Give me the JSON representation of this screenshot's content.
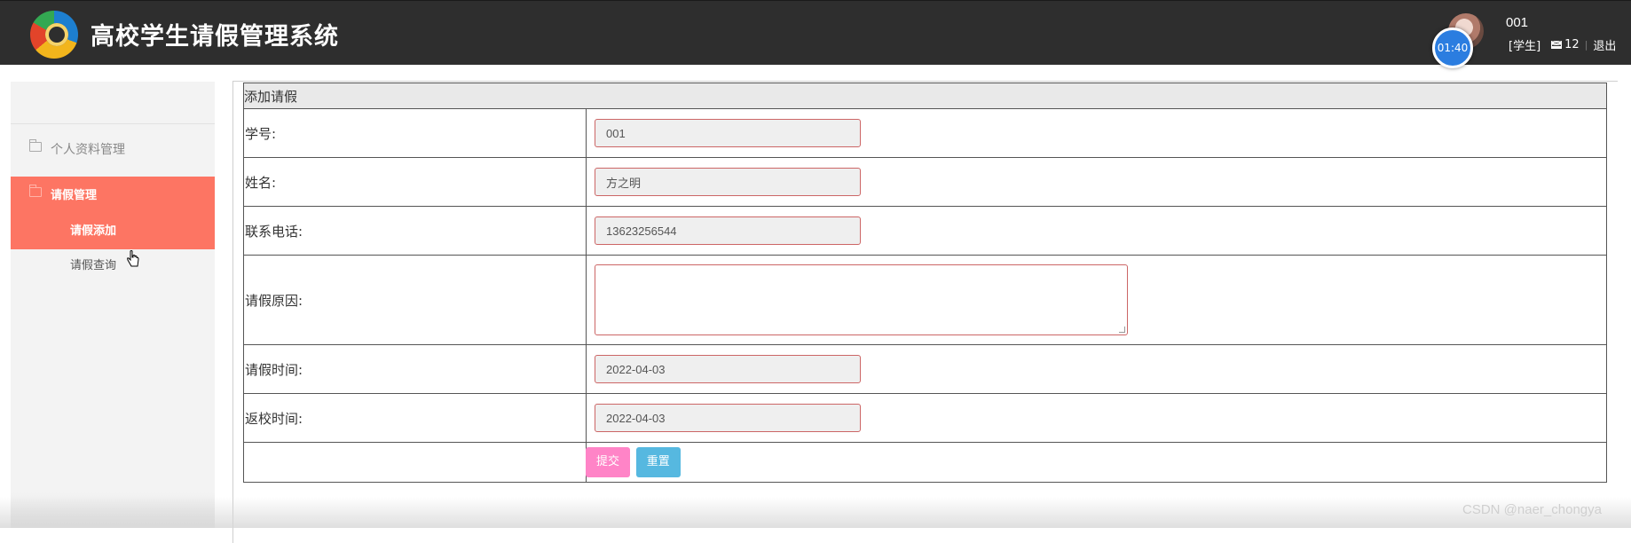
{
  "header": {
    "app_title": "高校学生请假管理系统",
    "timer": "01:40",
    "username": "001",
    "role": "[学生]",
    "mail_count": "12",
    "logout": "退出"
  },
  "sidebar": {
    "items": [
      {
        "label": "个人资料管理"
      },
      {
        "label": "请假管理",
        "children": [
          {
            "label": "请假添加"
          },
          {
            "label": "请假查询"
          }
        ]
      }
    ]
  },
  "form": {
    "caption": "添加请假",
    "fields": [
      {
        "label": "学号:",
        "value": "001"
      },
      {
        "label": "姓名:",
        "value": "方之明"
      },
      {
        "label": "联系电话:",
        "value": "13623256544"
      },
      {
        "label": "请假原因:",
        "value": ""
      },
      {
        "label": "请假时间:",
        "value": "2022-04-03"
      },
      {
        "label": "返校时间:",
        "value": "2022-04-03"
      }
    ],
    "submit_label": "提交",
    "reset_label": "重置"
  },
  "watermark": "CSDN @naer_chongya",
  "colors": {
    "header_bg": "#2e2e2e",
    "active_menu": "#fd7563",
    "submit_btn": "#ff84c7",
    "reset_btn": "#56b8e0"
  }
}
